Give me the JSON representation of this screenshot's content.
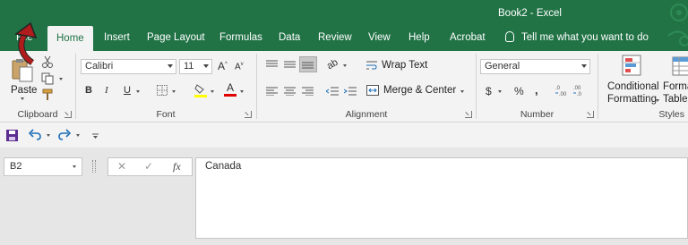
{
  "title": {
    "doc": "Book2  -  Excel"
  },
  "tabs": [
    {
      "label": "File"
    },
    {
      "label": "Home"
    },
    {
      "label": "Insert"
    },
    {
      "label": "Page Layout"
    },
    {
      "label": "Formulas"
    },
    {
      "label": "Data"
    },
    {
      "label": "Review"
    },
    {
      "label": "View"
    },
    {
      "label": "Help"
    },
    {
      "label": "Acrobat"
    }
  ],
  "tell_me": "Tell me what you want to do",
  "clipboard": {
    "paste_label": "Paste",
    "group_label": "Clipboard"
  },
  "font": {
    "name": "Calibri",
    "size": "11",
    "group_label": "Font",
    "bold": "B",
    "italic": "I",
    "underline": "U",
    "grow": "A",
    "shrink": "A",
    "font_color": "A"
  },
  "alignment": {
    "wrap_text": "Wrap Text",
    "merge_center": "Merge & Center",
    "group_label": "Alignment"
  },
  "number": {
    "format": "General",
    "currency": "$",
    "percent": "%",
    "comma": ",",
    "group_label": "Number"
  },
  "styles": {
    "conditional_line1": "Conditional",
    "conditional_line2": "Formatting",
    "format_table_line1": "Format",
    "format_table_line2": "Table",
    "group_label": "Styles"
  },
  "formula_bar": {
    "name_box": "B2",
    "cancel": "✕",
    "enter": "✓",
    "fx": "fx",
    "content": "Canada"
  },
  "colors": {
    "excel_green": "#217346",
    "ribbon_bg": "#f3f3f3",
    "annotation_arrow": "#b01c1c"
  }
}
